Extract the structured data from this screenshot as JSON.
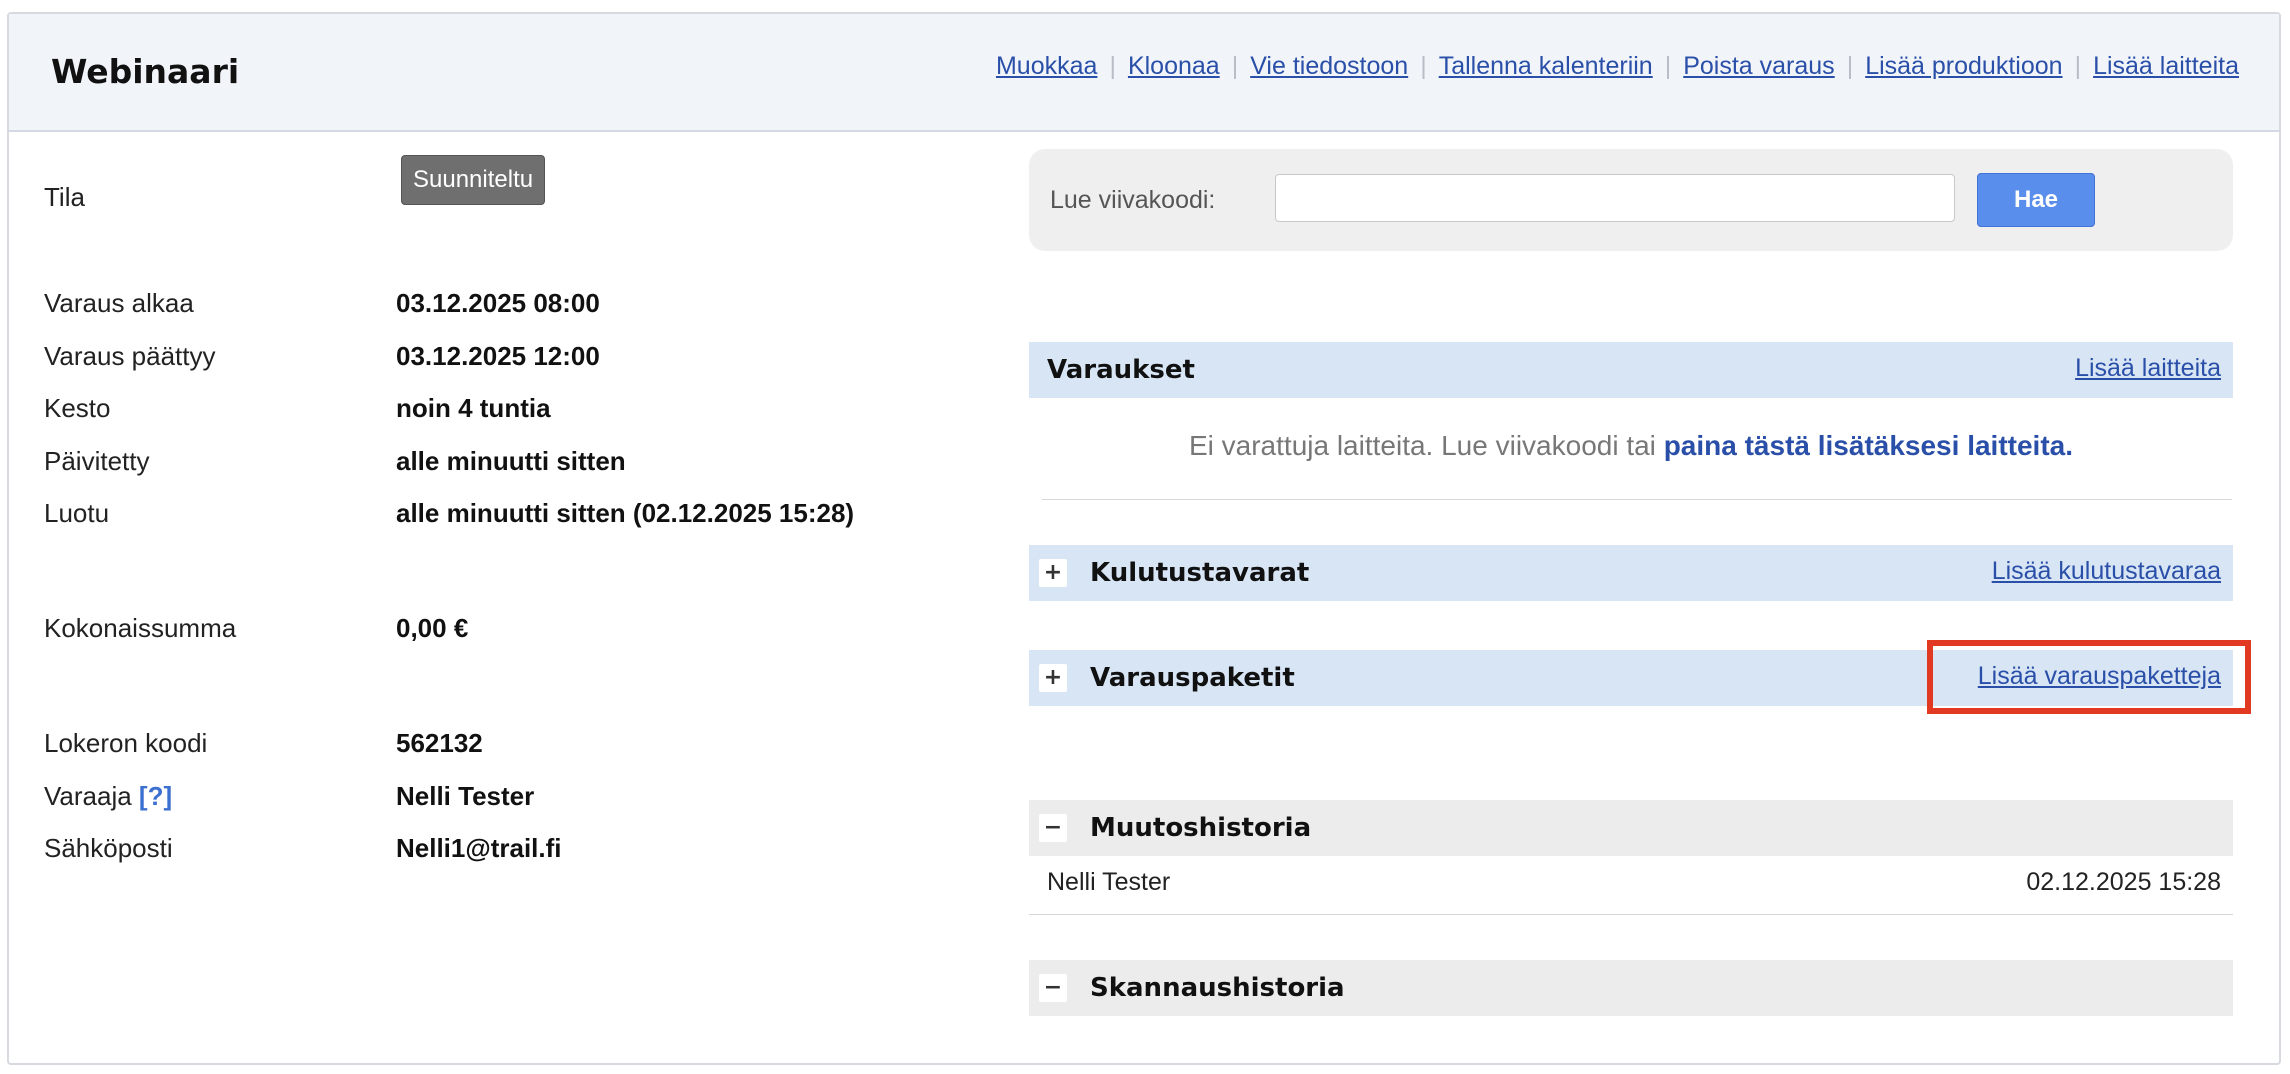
{
  "header": {
    "title": "Webinaari",
    "actions": [
      "Muokkaa",
      "Kloonaa",
      "Vie tiedostoon",
      "Tallenna kalenteriin",
      "Poista varaus",
      "Lisää produktioon",
      "Lisää laitteita"
    ]
  },
  "details": {
    "status_label": "Tila",
    "status_value": "Suunniteltu",
    "start_label": "Varaus alkaa",
    "start_value": "03.12.2025 08:00",
    "end_label": "Varaus päättyy",
    "end_value": "03.12.2025 12:00",
    "duration_label": "Kesto",
    "duration_value": "noin 4 tuntia",
    "updated_label": "Päivitetty",
    "updated_value": "alle minuutti sitten",
    "created_label": "Luotu",
    "created_value": "alle minuutti sitten (02.12.2025 15:28)",
    "total_label": "Kokonaissumma",
    "total_value": "0,00 €",
    "locker_label": "Lokeron koodi",
    "locker_value": "562132",
    "booker_label": "Varaaja",
    "booker_help": "[?]",
    "booker_value": "Nelli Tester",
    "email_label": "Sähköposti",
    "email_value": "Nelli1@trail.fi"
  },
  "barcode": {
    "label": "Lue viivakoodi:",
    "value": "",
    "button": "Hae"
  },
  "sections": {
    "reservations": {
      "title": "Varaukset",
      "link": "Lisää laitteita",
      "empty_text": "Ei varattuja laitteita. Lue viivakoodi tai ",
      "empty_link": "paina tästä lisätäksesi laitteita."
    },
    "consumables": {
      "toggle": "+",
      "title": "Kulutustavarat",
      "link": "Lisää kulutustavaraa"
    },
    "packages": {
      "toggle": "+",
      "title": "Varauspaketit",
      "link": "Lisää varauspaketteja"
    },
    "history": {
      "toggle": "−",
      "title": "Muutoshistoria",
      "rows": [
        {
          "user": "Nelli Tester",
          "time": "02.12.2025 15:28"
        }
      ]
    },
    "scan_history": {
      "toggle": "−",
      "title": "Skannaushistoria"
    }
  }
}
